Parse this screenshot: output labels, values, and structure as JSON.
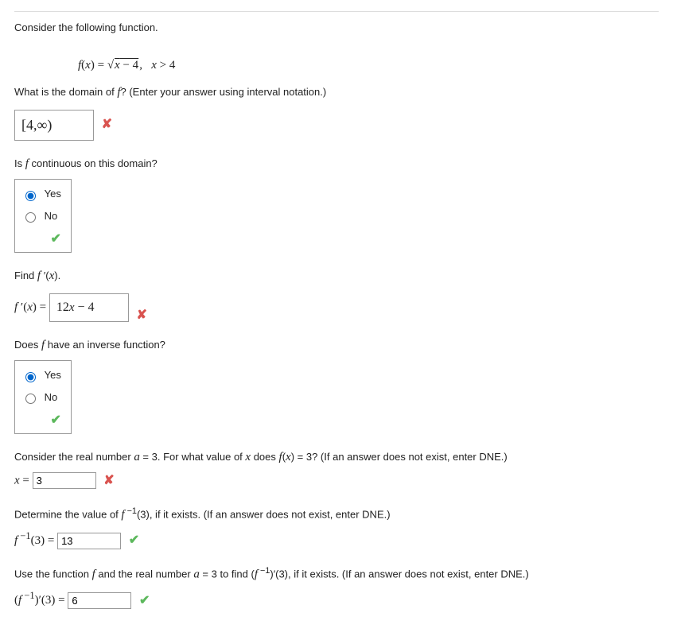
{
  "intro": "Consider the following function.",
  "function_def_html": "f(x) = √(x − 4),   x > 4",
  "q_domain": "What is the domain of f? (Enter your answer using interval notation.)",
  "ans_domain": "[4,∞)",
  "q_continuous": "Is f continuous on this domain?",
  "opt_yes": "Yes",
  "opt_no": "No",
  "q_fprime": "Find f ′(x).",
  "fprime_prefix": "f ′(x) = ",
  "ans_fprime": "12x − 4",
  "q_inverse": "Does f have an inverse function?",
  "q_realnum": "Consider the real number a = 3. For what value of x does f(x) = 3? (If an answer does not exist, enter DNE.)",
  "x_prefix": "x = ",
  "ans_x": "3",
  "q_finv3": "Determine the value of f⁻¹(3), if it exists. (If an answer does not exist, enter DNE.)",
  "finv3_prefix": "f⁻¹(3) = ",
  "ans_finv3": "13",
  "q_finvprime": "Use the function f and the real number a = 3 to find (f⁻¹)′(3), if it exists. (If an answer does not exist, enter DNE.)",
  "finvprime_prefix": "(f⁻¹)′(3) = ",
  "ans_finvprime": "6"
}
